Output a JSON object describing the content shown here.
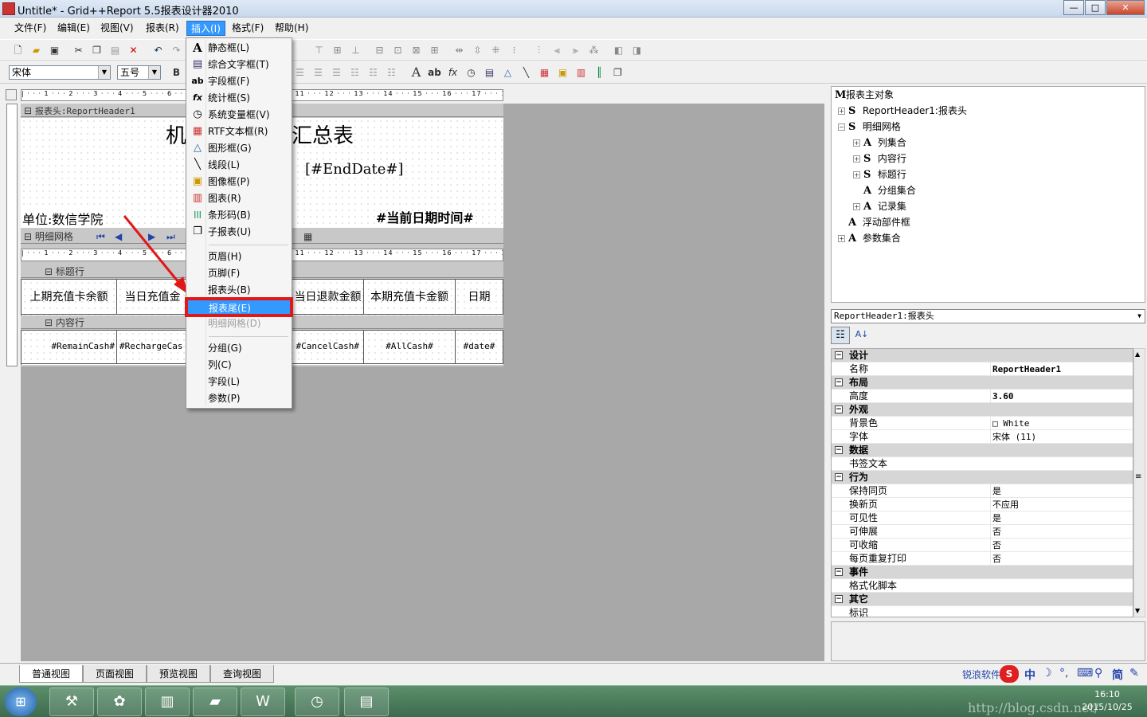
{
  "window": {
    "title": "Untitle* - Grid++Report 5.5报表设计器2010",
    "min": "—",
    "max": "□",
    "close": "✕"
  },
  "menubar": [
    "文件(F)",
    "编辑(E)",
    "视图(V)",
    "报表(R)",
    "插入(I)",
    "格式(F)",
    "帮助(H)"
  ],
  "active_menu_index": 4,
  "font_toolbar": {
    "font_name": "宋体",
    "font_size": "五号",
    "bold": "B"
  },
  "ruler": {
    "ticks": "| · · · 1 · · · 2 · · · 3 · · · 4 · · · 5 · · · 6 · · · 7 · · · 8 · · · 9 · · · 10 · · · 11 · · · 12 · · · 13 · · · 14 · · · 15 · · · 16 · · · 17 · · · 18"
  },
  "report_header": {
    "band_label": "报表头:ReportHeader1",
    "title_left": "机",
    "title_right": "汇总表",
    "end_date": "[#EndDate#]",
    "unit": "单位:数信学院",
    "datetime": "#当前日期时间#"
  },
  "detail_grid": {
    "band_label": "明细网格",
    "title_row_label": "标题行",
    "content_row_label": "内容行",
    "headers": [
      "上期充值卡余额",
      "当日充值金",
      "当日退款金额",
      "本期充值卡金额",
      "日期"
    ],
    "fields": [
      "#RemainCash#",
      "#RechargeCas",
      "#CancelCash#",
      "#AllCash#",
      "#date#"
    ]
  },
  "insert_menu": [
    {
      "icon": "A",
      "label": "静态框(L)"
    },
    {
      "icon": "▤",
      "label": "综合文字框(T)"
    },
    {
      "icon": "ab",
      "label": "字段框(F)"
    },
    {
      "icon": "fx",
      "label": "统计框(S)"
    },
    {
      "icon": "◷",
      "label": "系统变量框(V)"
    },
    {
      "icon": "▦",
      "label": "RTF文本框(R)"
    },
    {
      "icon": "△",
      "label": "图形框(G)"
    },
    {
      "icon": "╲",
      "label": "线段(L)"
    },
    {
      "icon": "▣",
      "label": "图像框(P)"
    },
    {
      "icon": "▥",
      "label": "图表(R)"
    },
    {
      "icon": "|||",
      "label": "条形码(B)"
    },
    {
      "icon": "❐",
      "label": "子报表(U)"
    },
    {
      "label": "页眉(H)"
    },
    {
      "label": "页脚(F)"
    },
    {
      "label": "报表头(B)"
    },
    {
      "label": "报表尾(E)"
    },
    {
      "label": "明细网格(D)"
    },
    {
      "label": "分组(G)"
    },
    {
      "label": "列(C)"
    },
    {
      "label": "字段(L)"
    },
    {
      "label": "参数(P)"
    }
  ],
  "highlighted_menu_item": "报表尾(E)",
  "tree": [
    {
      "icon": "M",
      "label": "报表主对象",
      "level": 0,
      "expander": ""
    },
    {
      "icon": "S",
      "label": "ReportHeader1:报表头",
      "level": 1,
      "expander": "+"
    },
    {
      "icon": "S",
      "label": "明细网格",
      "level": 1,
      "expander": "−"
    },
    {
      "icon": "A",
      "label": "列集合",
      "level": 2,
      "expander": "+"
    },
    {
      "icon": "S",
      "label": "内容行",
      "level": 2,
      "expander": "+"
    },
    {
      "icon": "S",
      "label": "标题行",
      "level": 2,
      "expander": "+"
    },
    {
      "icon": "A",
      "label": "分组集合",
      "level": 2,
      "expander": ""
    },
    {
      "icon": "A",
      "label": "记录集",
      "level": 2,
      "expander": "+"
    },
    {
      "icon": "A",
      "label": "浮动部件框",
      "level": 1,
      "expander": ""
    },
    {
      "icon": "A",
      "label": "参数集合",
      "level": 1,
      "expander": "+"
    }
  ],
  "property_panel": {
    "object": "ReportHeader1:报表头",
    "rows": [
      {
        "cat": "设计"
      },
      {
        "name": "名称",
        "value": "ReportHeader1"
      },
      {
        "cat": "布局"
      },
      {
        "name": "高度",
        "value": "3.60"
      },
      {
        "cat": "外观"
      },
      {
        "name": "背景色",
        "value": "□ White"
      },
      {
        "name": "字体",
        "value": "宋体 (11)"
      },
      {
        "cat": "数据"
      },
      {
        "name": "书签文本",
        "value": ""
      },
      {
        "cat": "行为"
      },
      {
        "name": "保持同页",
        "value": "是"
      },
      {
        "name": "换新页",
        "value": "不应用"
      },
      {
        "name": "可见性",
        "value": "是"
      },
      {
        "name": "可伸展",
        "value": "否"
      },
      {
        "name": "可收缩",
        "value": "否"
      },
      {
        "name": "每页重复打印",
        "value": "否"
      },
      {
        "cat": "事件"
      },
      {
        "name": "格式化脚本",
        "value": ""
      },
      {
        "cat": "其它"
      },
      {
        "name": "标识",
        "value": ""
      }
    ]
  },
  "view_tabs": [
    "普通视图",
    "页面视图",
    "预览视图",
    "查询视图"
  ],
  "active_view_tab": 0,
  "status_right": {
    "label": "锐浪软件",
    "ime": "中",
    "ime_simplified": "简"
  },
  "clock": {
    "time": "16:10",
    "date": "2015/10/25"
  },
  "watermark": "http://blog.csdn.net/",
  "colors": {
    "menu_highlight": "#3399ff",
    "annotation_red": "#e01818",
    "designer_bg": "#a8a8a8"
  }
}
